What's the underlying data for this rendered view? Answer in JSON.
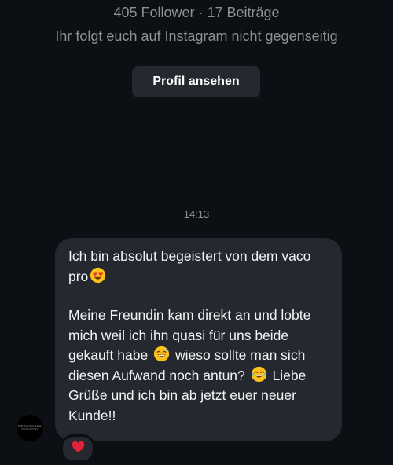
{
  "profile_header": {
    "stats": "405 Follower · 17 Beiträge",
    "follow_status": "Ihr folgt euch auf Instagram nicht gegenseitig",
    "view_profile_label": "Profil ansehen"
  },
  "thread": {
    "timestamp": "14:13",
    "sender_avatar": {
      "logo_text": "DEPICTURES",
      "logo_subtext": "PRODUCTIONS"
    },
    "message": {
      "line1_before": "Ich bin absolut begeistert von dem vaco pro",
      "line1_emoji": "heart-eyes-emoji",
      "p2_part1": "Meine Freundin kam direkt an und lobte mich weil ich ihn quasi für uns beide gekauft habe",
      "p2_emoji1": "sweat-smile-emoji",
      "p2_part2": "wieso sollte man sich diesen Aufwand noch antun?",
      "p2_emoji2": "tears-of-joy-emoji",
      "p2_part3": "Liebe Grüße und ich bin ab jetzt euer neuer Kunde!!"
    },
    "reaction": {
      "icon": "red-heart-icon",
      "color": "#e0233a"
    }
  },
  "colors": {
    "background": "#0c0f14",
    "bubble": "#25282e",
    "muted_text": "#8e9096",
    "text": "#f2f4f7"
  }
}
